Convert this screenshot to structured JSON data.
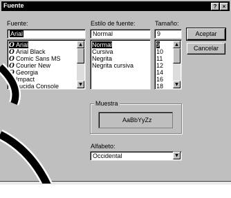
{
  "window": {
    "title": "Fuente",
    "help_label": "?",
    "close_label": "×"
  },
  "font": {
    "label": "Fuente:",
    "value": "Arial",
    "items": [
      "Arial",
      "Arial Black",
      "Comic Sans MS",
      "Courier New",
      "Georgia",
      "Impact",
      "Lucida Console"
    ],
    "selected": "Arial"
  },
  "style": {
    "label": "Estilo de fuente:",
    "value": "Normal",
    "items": [
      "Normal",
      "Cursiva",
      "Negrita",
      "Negrita cursiva"
    ],
    "selected": "Normal"
  },
  "size": {
    "label": "Tamaño:",
    "value": "9",
    "items": [
      "9",
      "10",
      "11",
      "12",
      "14",
      "16",
      "18"
    ],
    "selected": "9"
  },
  "buttons": {
    "ok": "Aceptar",
    "cancel": "Cancelar"
  },
  "sample": {
    "label": "Muestra",
    "text": "AaBbYyZz"
  },
  "script": {
    "label": "Alfabeto:",
    "value": "Occidental"
  },
  "icons": {
    "font_type": "truetype-font-icon",
    "scroll_up": "up-arrow-icon",
    "scroll_down": "down-arrow-icon",
    "dropdown": "dropdown-arrow-icon"
  }
}
